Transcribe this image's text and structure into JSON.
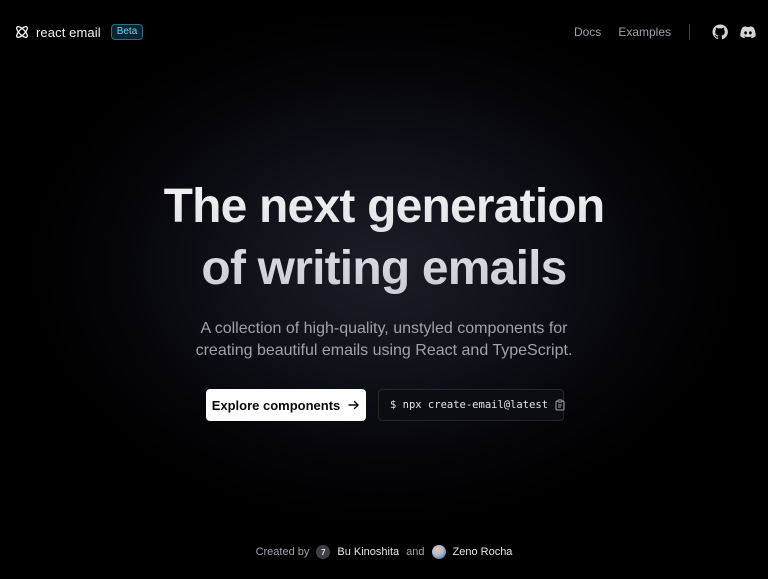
{
  "header": {
    "brand": "react email",
    "badge": "Beta",
    "nav": [
      {
        "label": "Docs"
      },
      {
        "label": "Examples"
      }
    ],
    "icons": [
      "github-icon",
      "discord-icon"
    ]
  },
  "hero": {
    "title_line1": "The next generation",
    "title_line2": "of writing emails",
    "subtitle_line1": "A collection of high-quality, unstyled components for",
    "subtitle_line2": "creating beautiful emails using React and TypeScript.",
    "cta_label": "Explore components",
    "command": "$ npx create-email@latest"
  },
  "footer": {
    "created_by": "Created by",
    "author1": "Bu Kinoshita",
    "author1_initial": "7",
    "and": "and",
    "author2": "Zeno Rocha"
  },
  "colors": {
    "background": "#000000",
    "beta_accent": "#6fd2f6",
    "cta_bg": "#ffffff",
    "muted_text": "#a1a1aa"
  }
}
